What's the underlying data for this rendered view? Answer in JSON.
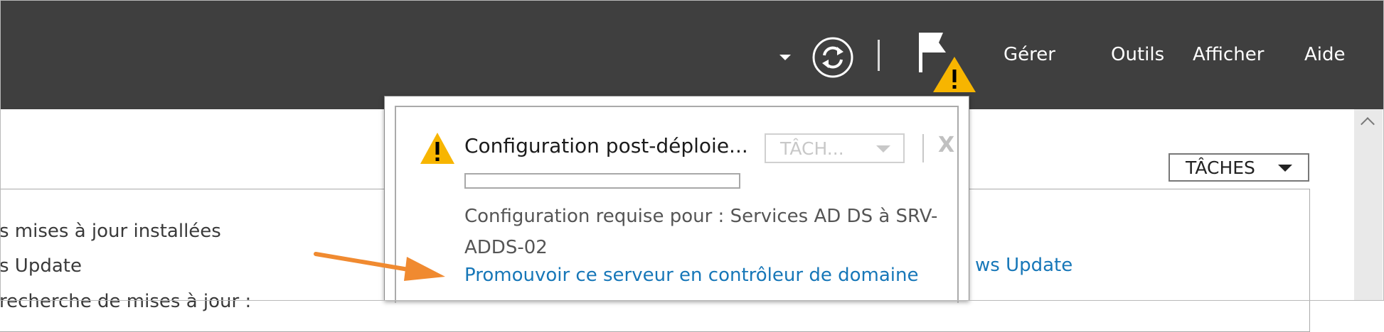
{
  "header": {
    "menu": [
      {
        "label": "Gérer"
      },
      {
        "label": "Outils"
      },
      {
        "label": "Afficher"
      },
      {
        "label": "Aide"
      }
    ],
    "icons": [
      "dropdown-arrow-icon",
      "refresh-icon",
      "flag-icon",
      "warning-icon"
    ],
    "background_color": "#3f3f3f"
  },
  "main": {
    "tasks_label": "TÂCHES",
    "left_lines": [
      "s mises à jour installées",
      "s Update",
      "recherche de mises à jour :"
    ],
    "right_link": "ws Update"
  },
  "notification": {
    "title": "Configuration post-déploie...",
    "tasks_label": "TÂCH...",
    "close_label": "X",
    "progress_percent": 0,
    "description": "Configuration requise pour : Services AD DS à SRV-ADDS-02",
    "link": "Promouvoir ce serveur en contrôleur de domaine"
  },
  "colors": {
    "accent_link": "#1777b8",
    "warning": "#f7b500",
    "annotation_arrow": "#f08a30"
  }
}
